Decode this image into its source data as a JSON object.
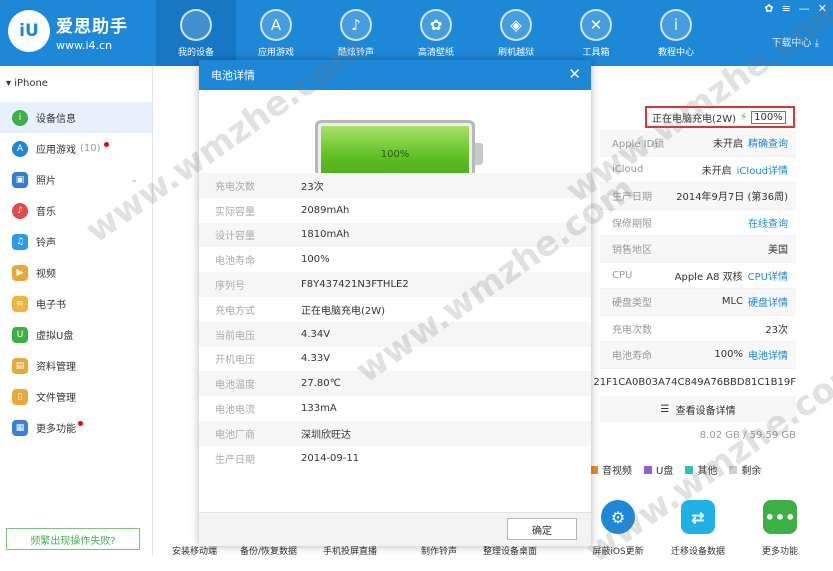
{
  "app": {
    "name": "爱思助手",
    "url": "www.i4.cn",
    "logo_text": "iU"
  },
  "nav": [
    {
      "label": "我的设备",
      "icon": "apple-icon",
      "glyph": ""
    },
    {
      "label": "应用游戏",
      "icon": "app-store-icon",
      "glyph": "A"
    },
    {
      "label": "酷炫铃声",
      "icon": "bell-icon",
      "glyph": "♪"
    },
    {
      "label": "高清壁纸",
      "icon": "flower-icon",
      "glyph": "✿"
    },
    {
      "label": "刷机越狱",
      "icon": "dropbox-icon",
      "glyph": "◈"
    },
    {
      "label": "工具箱",
      "icon": "tools-icon",
      "glyph": "✕"
    },
    {
      "label": "教程中心",
      "icon": "info-icon",
      "glyph": "i"
    }
  ],
  "window": {
    "download_label": "下载中心"
  },
  "sidebar": {
    "device": "iPhone",
    "items": [
      {
        "label": "设备信息",
        "icon": "info-icon",
        "color": "#3cb043",
        "glyph": "i"
      },
      {
        "label": "应用游戏",
        "icon": "app-store-icon",
        "color": "#1e88d8",
        "glyph": "A",
        "count": "(10)"
      },
      {
        "label": "照片",
        "icon": "photo-icon",
        "color": "#2f7fd9",
        "glyph": "▣"
      },
      {
        "label": "音乐",
        "icon": "music-icon",
        "color": "#e24a4a",
        "glyph": "♪"
      },
      {
        "label": "铃声",
        "icon": "bell-icon",
        "color": "#2b9be8",
        "glyph": "♫"
      },
      {
        "label": "视频",
        "icon": "video-icon",
        "color": "#e8a93a",
        "glyph": "▶"
      },
      {
        "label": "电子书",
        "icon": "book-icon",
        "color": "#f0b43c",
        "glyph": "≡"
      },
      {
        "label": "虚拟U盘",
        "icon": "usb-icon",
        "color": "#3cb043",
        "glyph": "U"
      },
      {
        "label": "资料管理",
        "icon": "contacts-icon",
        "color": "#e8a93a",
        "glyph": "▤"
      },
      {
        "label": "文件管理",
        "icon": "file-icon",
        "color": "#e8a93a",
        "glyph": "▯"
      },
      {
        "label": "更多功能",
        "icon": "more-icon",
        "color": "#3b7fd9",
        "glyph": "▦"
      }
    ],
    "feedback": "频繁出现操作失败?"
  },
  "device_info": {
    "charging_text": "正在电脑充电(2W)",
    "battery_percent": "100%",
    "rows": [
      {
        "label": "Apple ID锁",
        "value": "未开启",
        "link": "精确查询"
      },
      {
        "label": "iCloud",
        "value": "未开启",
        "link": "iCloud详情"
      },
      {
        "label": "生产日期",
        "value": "2014年9月7日 (第36周)",
        "link": ""
      },
      {
        "label": "保修期限",
        "value": "",
        "link": "在线查询"
      },
      {
        "label": "销售地区",
        "value": "美国",
        "link": ""
      },
      {
        "label": "CPU",
        "value": "Apple A8 双核",
        "link": "CPU详情"
      },
      {
        "label": "硬盘类型",
        "value": "MLC",
        "link": "硬盘详情"
      },
      {
        "label": "充电次数",
        "value": "23次",
        "link": ""
      },
      {
        "label": "电池寿命",
        "value": "100%",
        "link": "电池详情"
      }
    ],
    "serial": "21F1CA0B03A74C849A76BBD81C1B19F",
    "view_details": "查看设备详情",
    "storage": "8.02 GB / 59.59 GB",
    "legend": [
      {
        "label": "音视频",
        "color": "#e98f2c"
      },
      {
        "label": "U盘",
        "color": "#8e5fd8"
      },
      {
        "label": "其他",
        "color": "#2cc0c0"
      },
      {
        "label": "剩余",
        "color": "#cfcfcf"
      }
    ]
  },
  "toolbar": [
    {
      "label": "安装移动端",
      "icon": "mobile-install-icon",
      "color": "#1e88d8",
      "glyph": ""
    },
    {
      "label": "备份/恢复数据",
      "icon": "backup-icon",
      "color": "#1e88d8",
      "glyph": ""
    },
    {
      "label": "手机投屏直播",
      "icon": "screen-mirror-icon",
      "color": "#1e88d8",
      "glyph": ""
    },
    {
      "label": "制作铃声",
      "icon": "ringtone-icon",
      "color": "#1e88d8",
      "glyph": ""
    },
    {
      "label": "整理设备桌面",
      "icon": "desktop-organize-icon",
      "color": "#1e88d8",
      "glyph": ""
    },
    {
      "label": "屏蔽iOS更新",
      "icon": "block-update-icon",
      "color": "#1e88d8",
      "glyph": "⚙"
    },
    {
      "label": "迁移设备数据",
      "icon": "migrate-icon",
      "color": "#1fb2e6",
      "glyph": "⇄"
    },
    {
      "label": "更多功能",
      "icon": "more-dots-icon",
      "color": "#3cb043",
      "glyph": "•••"
    }
  ],
  "modal": {
    "title": "电池详情",
    "battery_level": "100%",
    "rows": [
      {
        "label": "充电次数",
        "value": "23次"
      },
      {
        "label": "实际容量",
        "value": "2089mAh"
      },
      {
        "label": "设计容量",
        "value": "1810mAh"
      },
      {
        "label": "电池寿命",
        "value": "100%"
      },
      {
        "label": "序列号",
        "value": "F8Y437421N3FTHLE2"
      },
      {
        "label": "充电方式",
        "value": "正在电脑充电(2W)"
      },
      {
        "label": "当前电压",
        "value": "4.34V"
      },
      {
        "label": "开机电压",
        "value": "4.33V"
      },
      {
        "label": "电池温度",
        "value": "27.80℃"
      },
      {
        "label": "电池电流",
        "value": "133mA"
      },
      {
        "label": "电池厂商",
        "value": "深圳欣旺达"
      },
      {
        "label": "生产日期",
        "value": "2014-09-11"
      }
    ],
    "ok_label": "确定"
  },
  "watermark": "www.wmzhe.com"
}
